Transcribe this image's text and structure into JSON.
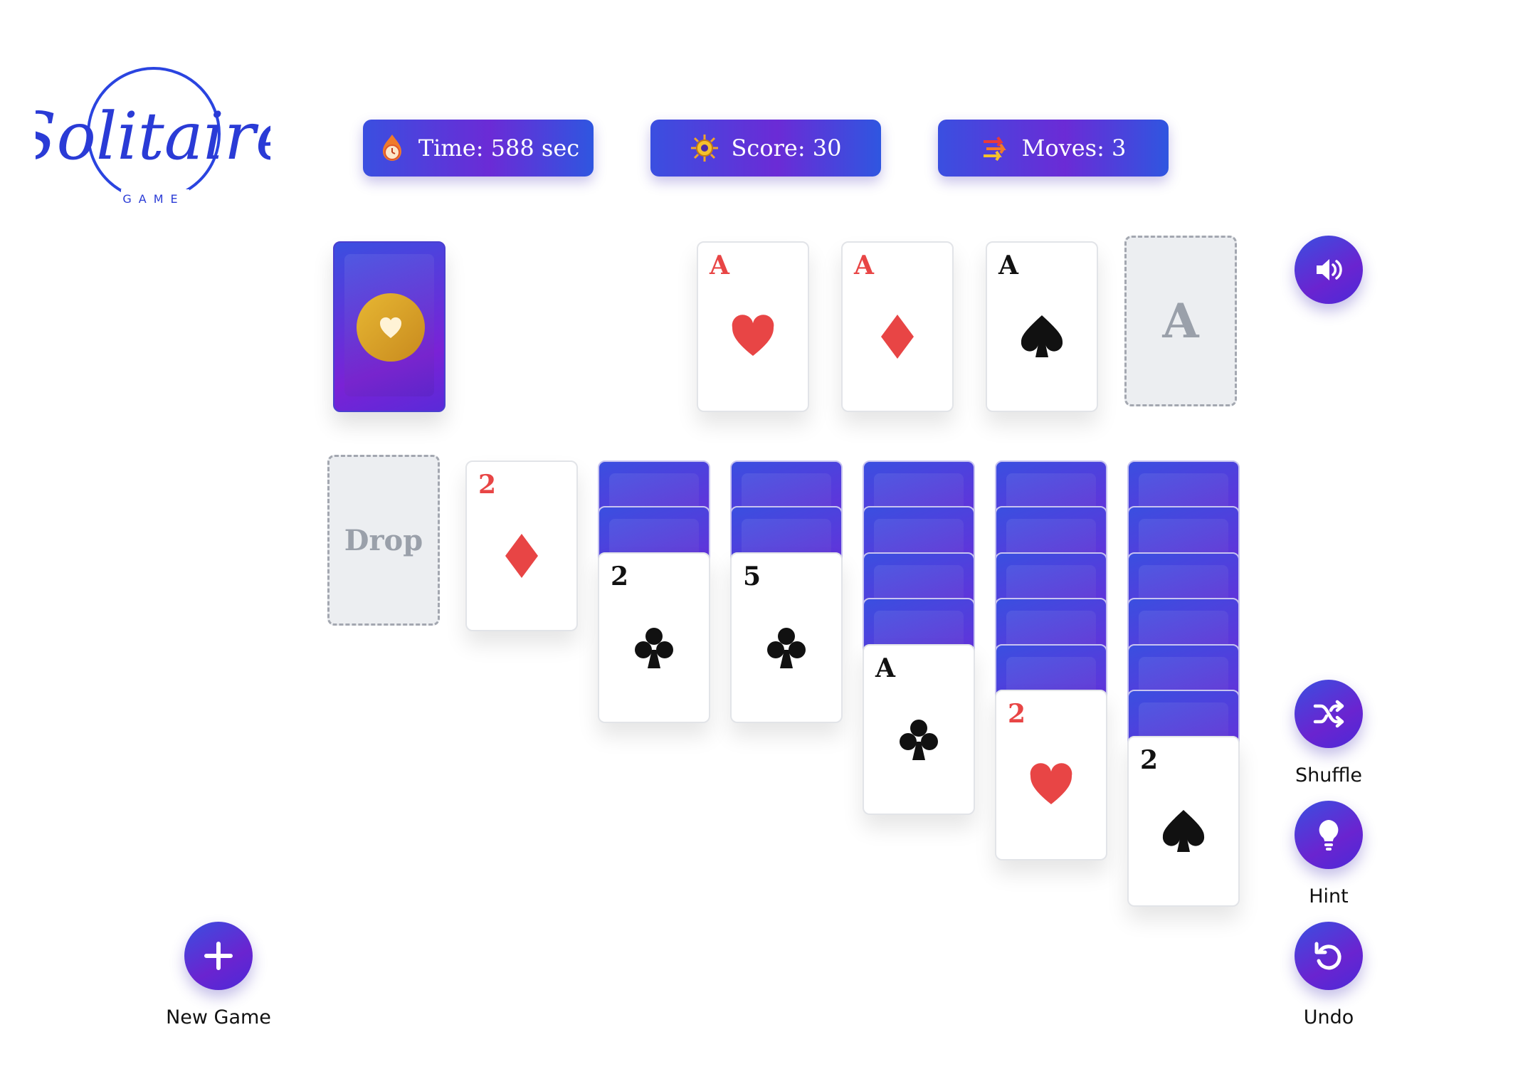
{
  "logo": {
    "word": "Solitaire",
    "sub": "GAME"
  },
  "stats": {
    "time_icon": "stopwatch-flame-icon",
    "time": "Time: 588 sec",
    "score_icon": "sun-badge-icon",
    "score": "Score: 30",
    "moves_icon": "arrows-icon",
    "moves": "Moves: 3"
  },
  "stock": {
    "icon": "heart-coin-icon"
  },
  "foundations": [
    {
      "rank": "A",
      "suit": "hearts",
      "color": "red"
    },
    {
      "rank": "A",
      "suit": "diamonds",
      "color": "red"
    },
    {
      "rank": "A",
      "suit": "spades",
      "color": "black"
    }
  ],
  "foundation_empty_label": "A",
  "waste_drop_label": "Drop",
  "tableau": [
    {
      "hidden": 0,
      "face": {
        "rank": "2",
        "suit": "diamonds",
        "color": "red"
      }
    },
    {
      "hidden": 2,
      "face": {
        "rank": "2",
        "suit": "clubs",
        "color": "black"
      }
    },
    {
      "hidden": 2,
      "face": {
        "rank": "5",
        "suit": "clubs",
        "color": "black"
      }
    },
    {
      "hidden": 4,
      "face": {
        "rank": "A",
        "suit": "clubs",
        "color": "black"
      }
    },
    {
      "hidden": 5,
      "face": {
        "rank": "2",
        "suit": "hearts",
        "color": "red"
      }
    },
    {
      "hidden": 6,
      "face": {
        "rank": "2",
        "suit": "spades",
        "color": "black"
      }
    }
  ],
  "controls": {
    "sound_icon": "speaker-icon",
    "shuffle": "Shuffle",
    "hint": "Hint",
    "undo": "Undo",
    "new_game": "New Game"
  },
  "colors": {
    "accent": "#5b2fd6",
    "red": "#e84545",
    "black": "#111111",
    "gold": "#d9a227"
  }
}
